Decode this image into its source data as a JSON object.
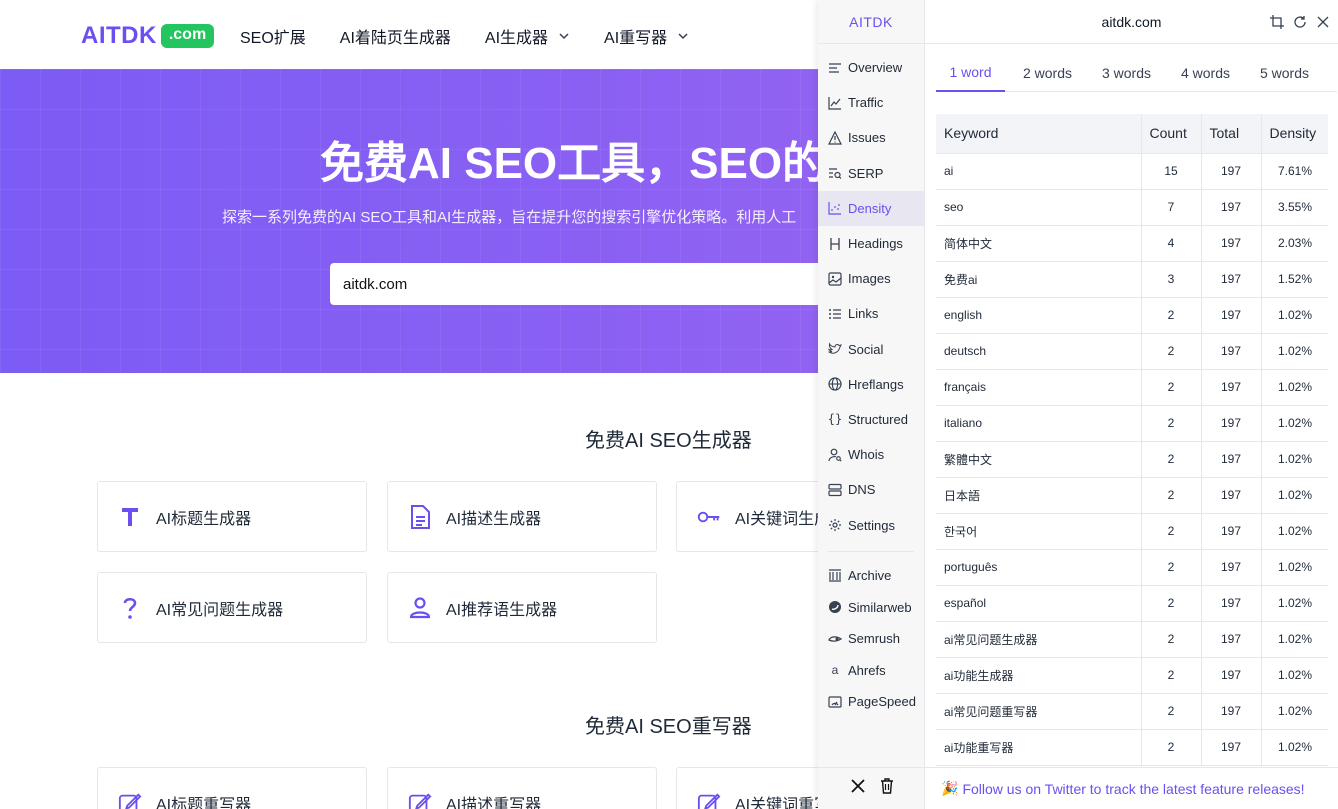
{
  "site": {
    "logo_text": "AITDK",
    "logo_badge": ".com",
    "nav": [
      {
        "label": "SEO扩展"
      },
      {
        "label": "AI着陆页生成器"
      },
      {
        "label": "AI生成器"
      },
      {
        "label": "AI重写器"
      }
    ],
    "hero_title": "免费AI SEO工具，SEO的",
    "hero_subtitle": "探索一系列免费的AI SEO工具和AI生成器，旨在提升您的搜索引擎优化策略。利用人工",
    "search_value": "aitdk.com",
    "section1_title": "免费AI SEO生成器",
    "cards1": [
      {
        "label": "AI标题生成器",
        "icon": "title-t-icon"
      },
      {
        "label": "AI描述生成器",
        "icon": "document-icon"
      },
      {
        "label": "AI关键词生成",
        "icon": "key-icon"
      },
      {
        "label": "AI常见问题生成器",
        "icon": "question-icon"
      },
      {
        "label": "AI推荐语生成器",
        "icon": "user-icon"
      }
    ],
    "section2_title": "免费AI SEO重写器",
    "cards2": [
      {
        "label": "AI标题重写器",
        "icon": "edit-icon"
      },
      {
        "label": "AI描述重写器",
        "icon": "edit-icon"
      },
      {
        "label": "AI关键词重写",
        "icon": "edit-icon"
      }
    ],
    "accent_color": "#6d4ef0"
  },
  "panel": {
    "brand": "AITDK",
    "url": "aitdk.com",
    "sidebar": [
      {
        "label": "Overview",
        "icon": "overview-icon"
      },
      {
        "label": "Traffic",
        "icon": "chart-line-icon"
      },
      {
        "label": "Issues",
        "icon": "warning-icon"
      },
      {
        "label": "SERP",
        "icon": "serp-icon"
      },
      {
        "label": "Density",
        "icon": "density-icon",
        "active": true
      },
      {
        "label": "Headings",
        "icon": "heading-icon"
      },
      {
        "label": "Images",
        "icon": "image-icon"
      },
      {
        "label": "Links",
        "icon": "list-icon"
      },
      {
        "label": "Social",
        "icon": "bird-icon"
      },
      {
        "label": "Hreflangs",
        "icon": "globe-icon"
      },
      {
        "label": "Structured",
        "icon": "braces-icon"
      },
      {
        "label": "Whois",
        "icon": "person-search-icon"
      },
      {
        "label": "DNS",
        "icon": "server-icon"
      },
      {
        "label": "Settings",
        "icon": "gear-icon"
      }
    ],
    "external": [
      {
        "label": "Archive",
        "icon": "archive-icon"
      },
      {
        "label": "Similarweb",
        "icon": "similarweb-icon"
      },
      {
        "label": "Semrush",
        "icon": "semrush-icon"
      },
      {
        "label": "Ahrefs",
        "icon": "ahrefs-icon"
      },
      {
        "label": "PageSpeed",
        "icon": "pagespeed-icon"
      }
    ],
    "tabs": [
      {
        "label": "1 word",
        "active": true
      },
      {
        "label": "2 words"
      },
      {
        "label": "3 words"
      },
      {
        "label": "4 words"
      },
      {
        "label": "5 words"
      }
    ],
    "columns": [
      "Keyword",
      "Count",
      "Total",
      "Density"
    ],
    "rows": [
      {
        "keyword": "ai",
        "count": "15",
        "total": "197",
        "density": "7.61%"
      },
      {
        "keyword": "seo",
        "count": "7",
        "total": "197",
        "density": "3.55%"
      },
      {
        "keyword": "简体中文",
        "count": "4",
        "total": "197",
        "density": "2.03%"
      },
      {
        "keyword": "免费ai",
        "count": "3",
        "total": "197",
        "density": "1.52%"
      },
      {
        "keyword": "english",
        "count": "2",
        "total": "197",
        "density": "1.02%"
      },
      {
        "keyword": "deutsch",
        "count": "2",
        "total": "197",
        "density": "1.02%"
      },
      {
        "keyword": "français",
        "count": "2",
        "total": "197",
        "density": "1.02%"
      },
      {
        "keyword": "italiano",
        "count": "2",
        "total": "197",
        "density": "1.02%"
      },
      {
        "keyword": "繁體中文",
        "count": "2",
        "total": "197",
        "density": "1.02%"
      },
      {
        "keyword": "日本語",
        "count": "2",
        "total": "197",
        "density": "1.02%"
      },
      {
        "keyword": "한국어",
        "count": "2",
        "total": "197",
        "density": "1.02%"
      },
      {
        "keyword": "português",
        "count": "2",
        "total": "197",
        "density": "1.02%"
      },
      {
        "keyword": "español",
        "count": "2",
        "total": "197",
        "density": "1.02%"
      },
      {
        "keyword": "ai常见问题生成器",
        "count": "2",
        "total": "197",
        "density": "1.02%"
      },
      {
        "keyword": "ai功能生成器",
        "count": "2",
        "total": "197",
        "density": "1.02%"
      },
      {
        "keyword": "ai常见问题重写器",
        "count": "2",
        "total": "197",
        "density": "1.02%"
      },
      {
        "keyword": "ai功能重写器",
        "count": "2",
        "total": "197",
        "density": "1.02%"
      }
    ],
    "footer_emoji": "🎉",
    "footer_text": "Follow us on Twitter to track the latest feature releases!"
  }
}
